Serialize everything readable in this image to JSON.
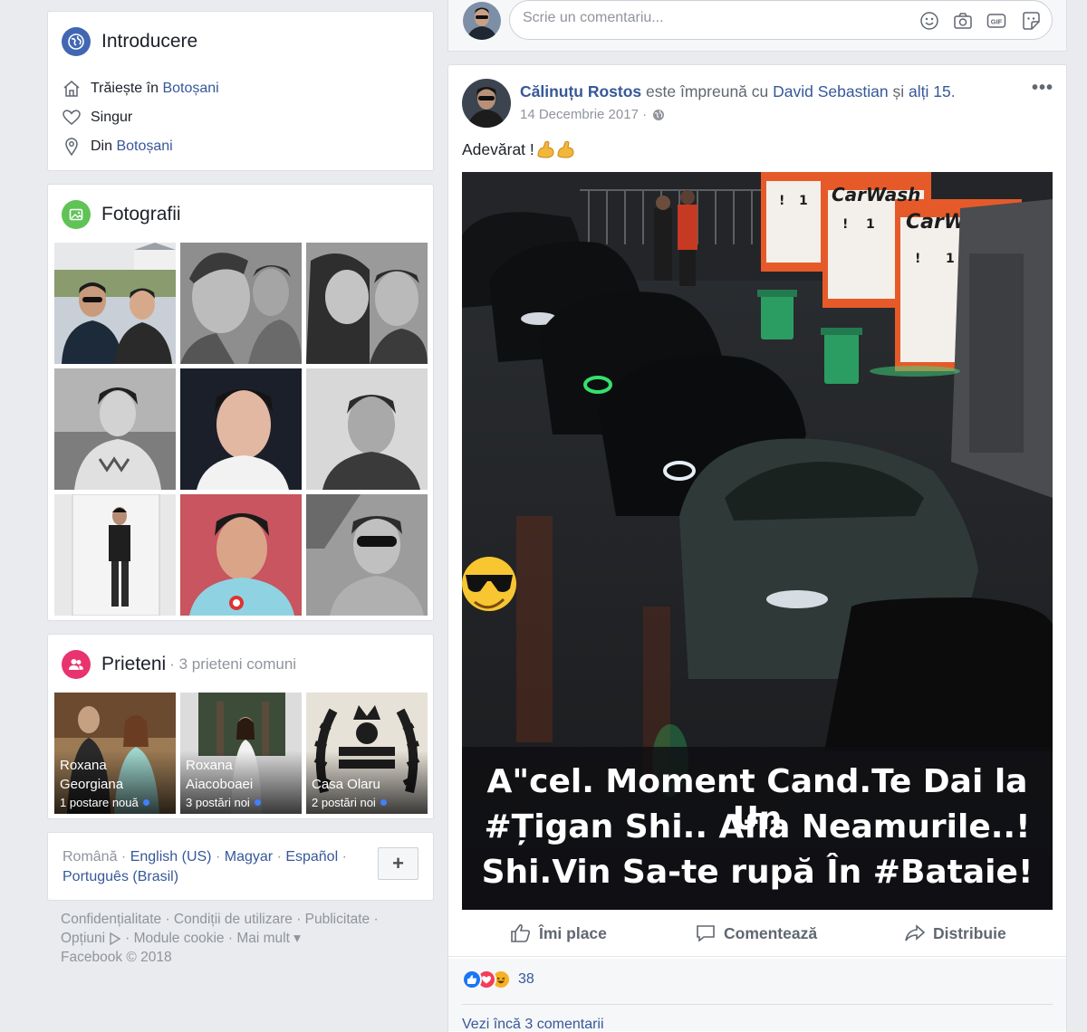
{
  "intro": {
    "title": "Introducere",
    "lives_prefix": "Trăiește în",
    "lives_city": "Botoșani",
    "relationship": "Singur",
    "from_prefix": "Din",
    "from_city": "Botoșani"
  },
  "photos": {
    "title": "Fotografii"
  },
  "friends": {
    "title": "Prieteni",
    "mutual": "· 3 prieteni comuni",
    "items": [
      {
        "name": "Roxana Georgiana",
        "sub": "1 postare nouă"
      },
      {
        "name": "Roxana Aiacoboaei",
        "sub": "3 postări noi"
      },
      {
        "name": "Casa Olaru",
        "sub": "2 postări noi"
      }
    ]
  },
  "languages": {
    "current": "Română",
    "others": [
      "English (US)",
      "Magyar",
      "Español",
      "Português (Brasil)"
    ],
    "add_label": "+"
  },
  "footer": {
    "line1": "Confidențialitate · Condiții de utilizare · Publicitate ·",
    "line2a": "Opțiuni",
    "line2b": "· Module cookie · Mai mult ▾",
    "line3": "Facebook © 2018"
  },
  "composer": {
    "placeholder": "Scrie un comentariu..."
  },
  "post": {
    "author": "Călinuțu Rostos",
    "with_text": "este împreună cu",
    "tagged": "David Sebastian",
    "and_text": "și",
    "others": "alți 15",
    "date": "14 Decembrie 2017 ·",
    "text": "Adevărat !",
    "more": "•••",
    "image": {
      "sign1": "CarWash",
      "sign2": "CarW",
      "caption_line1": "A\"cel. Moment Cand.Te Dai la Un",
      "caption_line2": "#Țigan Shi.. Afla Neamurile..!",
      "caption_line3": "Shi.Vin Sa-te rupă În #Bataie!"
    },
    "actions": {
      "like": "Îmi place",
      "comment": "Comentează",
      "share": "Distribuie"
    },
    "reaction_count": "38",
    "view_more": "Vezi încă 3 comentarii"
  },
  "colors": {
    "link": "#365899",
    "intro_icon": "#4267b2",
    "photos_icon": "#5fc355",
    "friends_icon": "#e8336f",
    "like_blue": "#1877f2",
    "love_red": "#f33e58",
    "haha_yellow": "#f7b125"
  }
}
